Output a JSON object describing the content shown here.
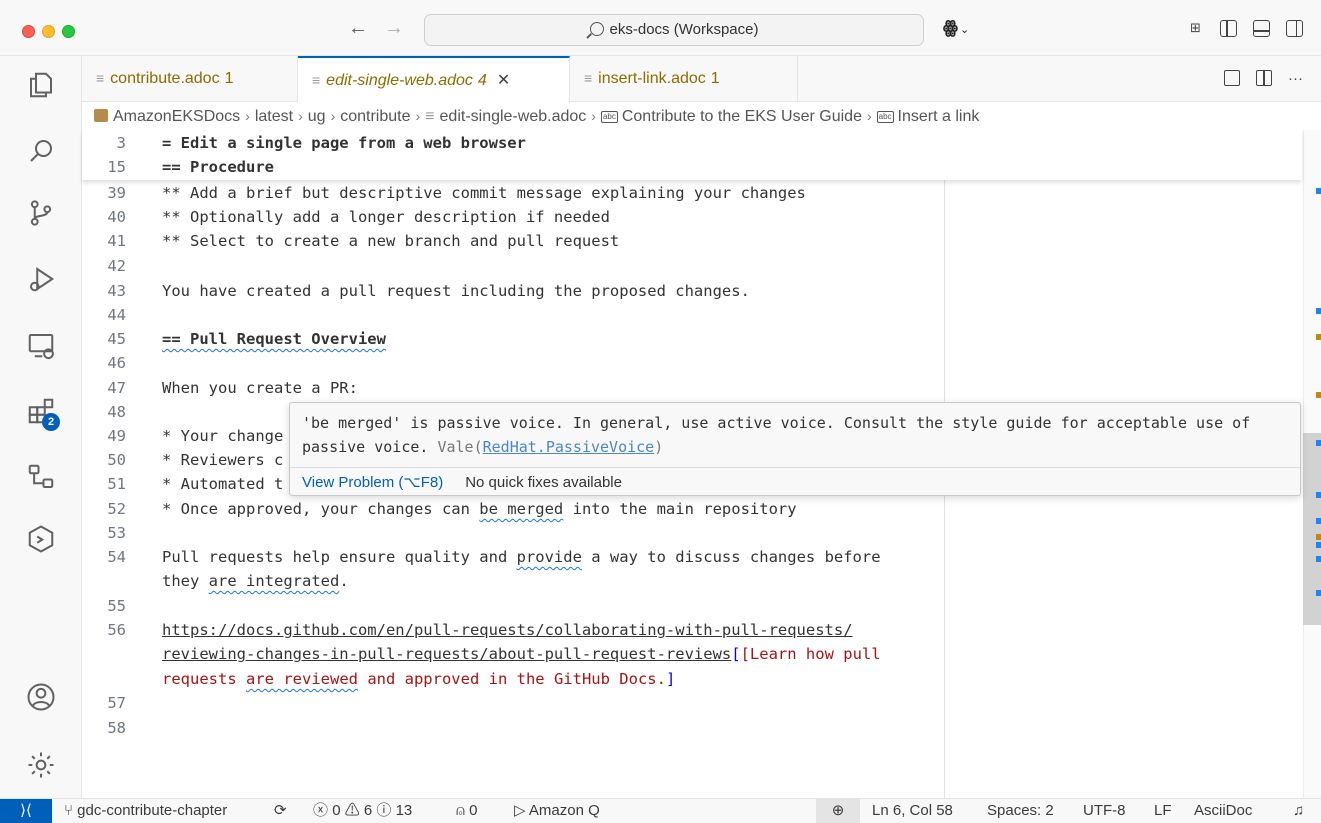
{
  "window": {
    "title": "eks-docs (Workspace)"
  },
  "tabs": [
    {
      "name": "contribute.adoc",
      "problems": "1",
      "active": false
    },
    {
      "name": "edit-single-web.adoc",
      "problems": "4",
      "active": true
    },
    {
      "name": "insert-link.adoc",
      "problems": "1",
      "active": false
    }
  ],
  "breadcrumb": [
    "AmazonEKSDocs",
    "latest",
    "ug",
    "contribute",
    "edit-single-web.adoc",
    "Contribute to the EKS User Guide",
    "Insert a link"
  ],
  "activity_bar": {
    "extensions_badge": "2",
    "items": [
      "explorer-icon",
      "search-icon",
      "source-control-icon",
      "run-debug-icon",
      "remote-explorer-icon",
      "extensions-icon",
      "hierarchy-icon",
      "amazon-q-icon",
      "account-icon",
      "settings-gear-icon"
    ]
  },
  "editor": {
    "sticky": [
      {
        "num": "3",
        "text": "= Edit a single page from a web browser"
      },
      {
        "num": "15",
        "text": "== Procedure"
      }
    ],
    "lines": [
      {
        "num": "39",
        "text": "** Add a brief but descriptive commit message explaining your changes"
      },
      {
        "num": "40",
        "text": "** Optionally add a longer description if needed"
      },
      {
        "num": "41",
        "text": "** Select to create a new branch and pull request"
      },
      {
        "num": "42",
        "text": ""
      },
      {
        "num": "43",
        "text": "You have created a pull request including the proposed changes."
      },
      {
        "num": "44",
        "text": ""
      },
      {
        "num": "45",
        "text": "== Pull Request Overview"
      },
      {
        "num": "46",
        "text": ""
      },
      {
        "num": "47",
        "text": "When you create a PR:"
      },
      {
        "num": "48",
        "text": ""
      },
      {
        "num": "49",
        "text": "* Your change"
      },
      {
        "num": "50",
        "text": "* Reviewers c"
      },
      {
        "num": "51",
        "text": "* Automated t"
      },
      {
        "num": "52a",
        "text": "* Once approved, your changes can "
      },
      {
        "num": "52b",
        "text": "be merged"
      },
      {
        "num": "52c",
        "text": " into the main repository"
      },
      {
        "num": "53",
        "text": ""
      },
      {
        "num": "54a",
        "text": "Pull requests help ensure quality and "
      },
      {
        "num": "54b",
        "text": "provide"
      },
      {
        "num": "54c",
        "text": " a way to discuss changes before"
      },
      {
        "num": "54d",
        "text": "they "
      },
      {
        "num": "54e",
        "text": "are integrated"
      },
      {
        "num": "54f",
        "text": "."
      },
      {
        "num": "55",
        "text": ""
      },
      {
        "num": "56a",
        "text": "https://docs.github.com/en/pull-requests/collaborating-with-pull-requests/"
      },
      {
        "num": "56b",
        "text": "reviewing-changes-in-pull-requests/about-pull-request-reviews"
      },
      {
        "num": "56c",
        "text": "[Learn how pull"
      },
      {
        "num": "56d",
        "text": "requests "
      },
      {
        "num": "56e",
        "text": "are reviewed"
      },
      {
        "num": "56f",
        "text": " and approved in the GitHub Docs."
      },
      {
        "num": "56g",
        "text": "]"
      },
      {
        "num": "57",
        "text": ""
      },
      {
        "num": "58",
        "text": ""
      }
    ],
    "line_numbers": [
      "39",
      "40",
      "41",
      "42",
      "43",
      "44",
      "45",
      "46",
      "47",
      "48",
      "49",
      "50",
      "51",
      "52",
      "53",
      "54",
      "55",
      "56",
      "57",
      "58"
    ]
  },
  "hover": {
    "message": "'be merged' is passive voice. In general, use active voice. Consult the style guide for acceptable use of passive voice.",
    "source": "Vale(",
    "rule": "RedHat.PassiveVoice",
    "source_close": ")",
    "view_problem": "View Problem (⌥F8)",
    "no_fixes": "No quick fixes available"
  },
  "statusbar": {
    "branch": "gdc-contribute-chapter",
    "errors": "0",
    "warnings": "6",
    "infos": "13",
    "ports": "0",
    "amazon_q": "Amazon Q",
    "cursor": "Ln 6, Col 58",
    "spaces": "Spaces: 2",
    "encoding": "UTF-8",
    "eol": "LF",
    "language": "AsciiDoc"
  }
}
